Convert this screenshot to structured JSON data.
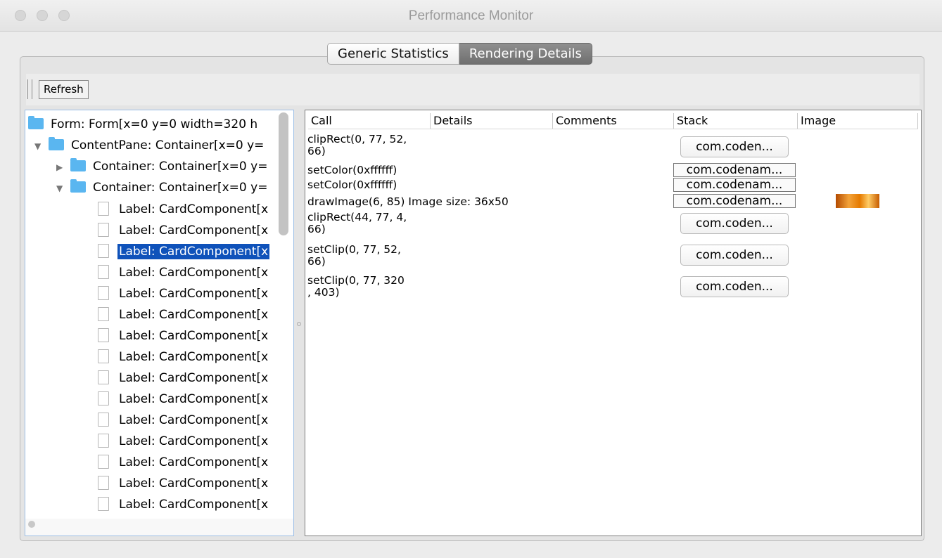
{
  "window": {
    "title": "Performance Monitor"
  },
  "tabs": [
    {
      "label": "Generic Statistics",
      "selected": false
    },
    {
      "label": "Rendering Details",
      "selected": true
    }
  ],
  "toolbar": {
    "refresh_label": "Refresh"
  },
  "tree": {
    "root": "Form: Form[x=0 y=0 width=320 h",
    "content_pane": "ContentPane: Container[x=0 y=",
    "container_collapsed": "Container: Container[x=0 y=",
    "container_expanded": "Container: Container[x=0 y=",
    "labels": [
      "Label: CardComponent[x",
      "Label: CardComponent[x",
      "Label: CardComponent[x",
      "Label: CardComponent[x",
      "Label: CardComponent[x",
      "Label: CardComponent[x",
      "Label: CardComponent[x",
      "Label: CardComponent[x",
      "Label: CardComponent[x",
      "Label: CardComponent[x",
      "Label: CardComponent[x",
      "Label: CardComponent[x",
      "Label: CardComponent[x",
      "Label: CardComponent[x",
      "Label: CardComponent[x"
    ],
    "selected_index": 2
  },
  "table": {
    "columns": [
      "Call",
      "Details",
      "Comments",
      "Stack",
      "Image"
    ],
    "rows": [
      {
        "call": "clipRect(0, 77, 52,\n66)",
        "stack": "com.coden..."
      },
      {
        "call": "setColor(0xffffff)",
        "stack": "com.codenam..."
      },
      {
        "call": "setColor(0xffffff)",
        "stack": "com.codenam..."
      },
      {
        "call": "drawImage(6, 85) Image size: 36x50",
        "stack": "com.codenam..."
      },
      {
        "call": "clipRect(44, 77, 4,\n66)",
        "stack": "com.coden..."
      },
      {
        "call": "setClip(0, 77, 52,\n66)",
        "stack": "com.coden..."
      },
      {
        "call": "setClip(0, 77, 320\n, 403)",
        "stack": "com.coden..."
      }
    ]
  }
}
